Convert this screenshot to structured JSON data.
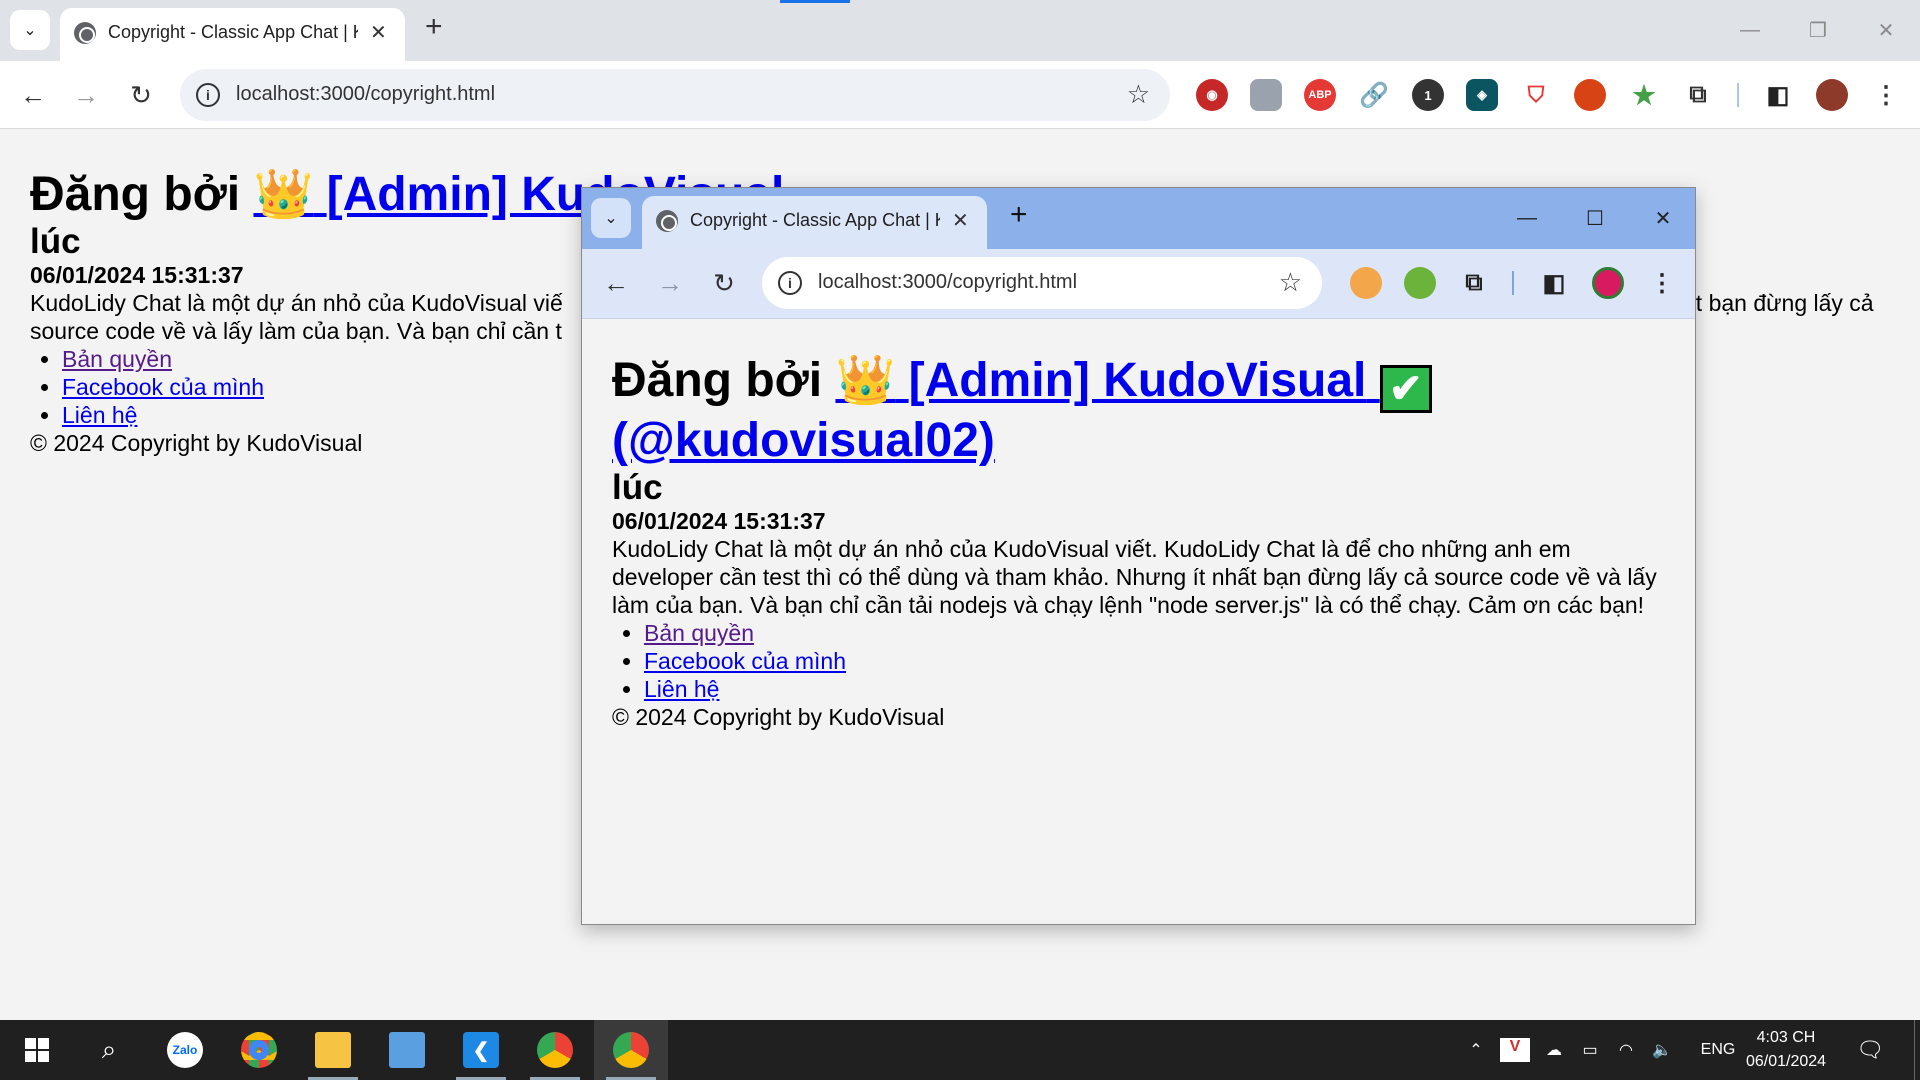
{
  "browser": {
    "tab_title": "Copyright - Classic App Chat | K",
    "url": "localhost:3000/copyright.html",
    "new_tab_label": "+"
  },
  "page": {
    "heading_prefix": "Đăng bởi",
    "crown_emoji": "👑",
    "admin_link": "[Admin] KudoVisual",
    "check_emoji": "✔",
    "handle_link": "(@kudovisual02)",
    "at_label": "lúc",
    "timestamp": "06/01/2024 15:31:37",
    "description": "KudoLidy Chat là một dự án nhỏ của KudoVisual viết. KudoLidy Chat là để cho những anh em developer cần test thì có thể dùng và tham khảo. Nhưng ít nhất bạn đừng lấy cả source code về và lấy làm của bạn. Và bạn chỉ cần tải nodejs và chạy lệnh \"node server.js\" là có thể chạy. Cảm ơn các bạn!",
    "back_description_line1_left": "KudoLidy Chat là một dự án nhỏ của KudoVisual viế",
    "back_description_line1_right": "ất bạn đừng lấy cả",
    "back_description_line2_left": "source code về và lấy làm của bạn. Và bạn chỉ cần t",
    "links": [
      {
        "label": "Bản quyền",
        "visited": true
      },
      {
        "label": "Facebook của mình",
        "visited": false
      },
      {
        "label": "Liên hệ",
        "visited": false
      }
    ],
    "footer": "© 2024 Copyright by KudoVisual"
  },
  "taskbar": {
    "apps": [
      {
        "name": "start",
        "icon": "windows-logo-icon"
      },
      {
        "name": "search",
        "icon": "search-icon"
      },
      {
        "name": "Zalo",
        "icon": "zalo-icon",
        "label": "Zalo"
      },
      {
        "name": "Chrome",
        "icon": "chrome-icon"
      },
      {
        "name": "File Explorer",
        "icon": "folder-icon"
      },
      {
        "name": "Control Panel",
        "icon": "control-panel-icon"
      },
      {
        "name": "Visual Studio Code",
        "icon": "vscode-icon"
      },
      {
        "name": "Chrome Profile",
        "icon": "chrome-profile-icon"
      },
      {
        "name": "Chrome Active",
        "icon": "chrome-icon"
      }
    ],
    "language": "ENG",
    "time": "4:03 CH",
    "date": "06/01/2024"
  },
  "colors": {
    "link": "#0000ee",
    "visited_link": "#551a8b",
    "front_frame": "#8cb0ea",
    "back_tabstrip": "#dfe3e8",
    "taskbar": "#202020"
  }
}
